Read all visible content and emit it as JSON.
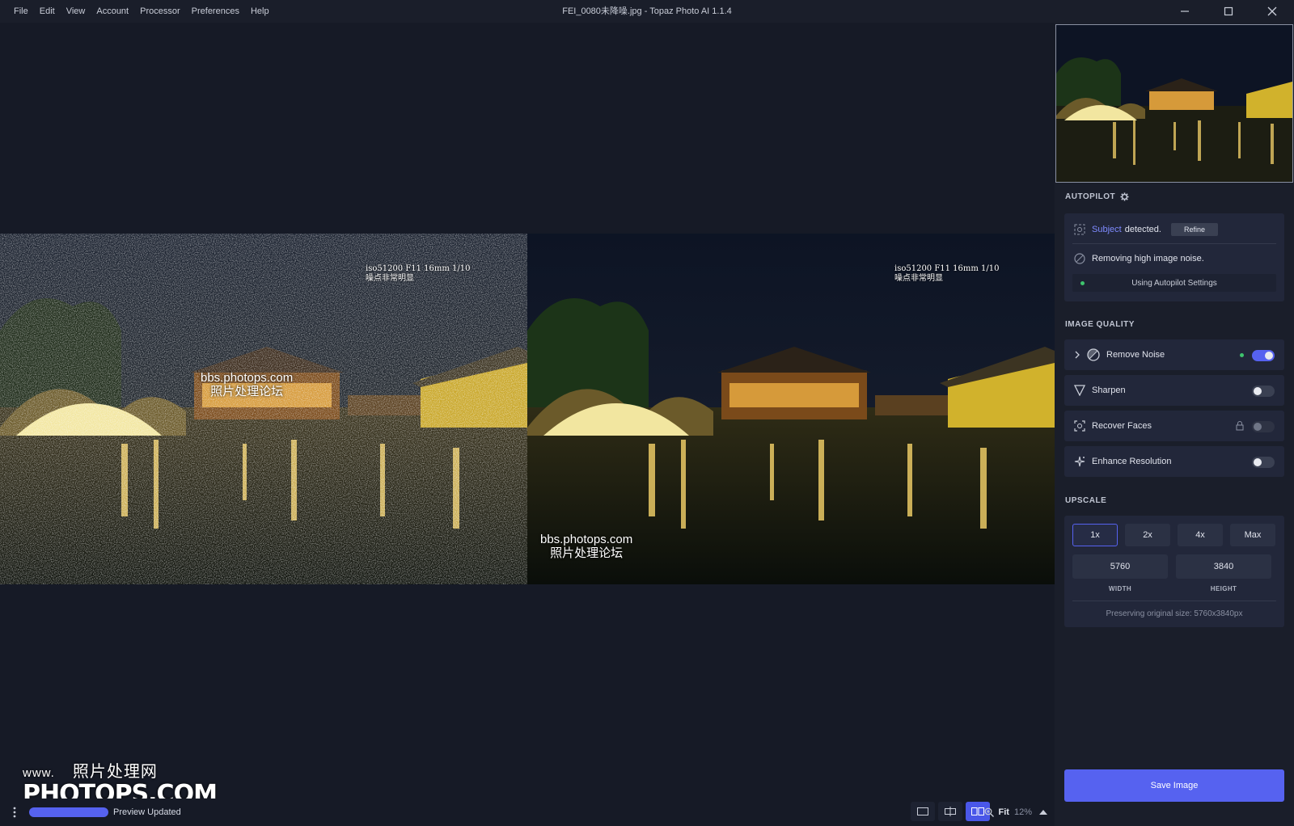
{
  "window": {
    "title": "FEI_0080未降噪.jpg - Topaz Photo AI 1.1.4",
    "menu": [
      "File",
      "Edit",
      "View",
      "Account",
      "Processor",
      "Preferences",
      "Help"
    ]
  },
  "canvas": {
    "left_overlay": {
      "exif_line1": "iso51200 F11 16mm 1/10",
      "exif_line2": "噪点非常明显"
    },
    "right_overlay": {
      "exif_line1": "iso51200 F11 16mm 1/10",
      "exif_line2": "噪点非常明显"
    },
    "watermark_left": {
      "line1": "bbs.photops.com",
      "line2": "照片处理论坛"
    },
    "watermark_right": {
      "line1": "bbs.photops.com",
      "line2": "照片处理论坛"
    },
    "brand_watermark": {
      "line1_prefix": "www.",
      "line1": "照片处理网",
      "line2": "PHOTOPS.COM"
    }
  },
  "statusbar": {
    "preview_label": "Preview Updated",
    "preview_progress": 1.0,
    "zoom_fit": "Fit",
    "zoom_pct": "12%",
    "active_view_mode": "side-by-side"
  },
  "autopilot": {
    "heading": "AUTOPILOT",
    "subject_word": "Subject",
    "detected_text": "detected.",
    "refine_label": "Refine",
    "noise_msg": "Removing high image noise.",
    "settings_label": "Using Autopilot Settings"
  },
  "image_quality": {
    "heading": "IMAGE QUALITY",
    "items": [
      {
        "label": "Remove Noise",
        "enabled": true
      },
      {
        "label": "Sharpen",
        "enabled": false
      },
      {
        "label": "Recover Faces",
        "enabled": false,
        "locked": true
      },
      {
        "label": "Enhance Resolution",
        "enabled": false
      }
    ]
  },
  "upscale": {
    "heading": "UPSCALE",
    "options": [
      "1x",
      "2x",
      "4x",
      "Max"
    ],
    "selected": "1x",
    "width_value": "5760",
    "height_value": "3840",
    "width_label": "WIDTH",
    "height_label": "HEIGHT",
    "preserve_text": "Preserving original size: 5760x3840px"
  },
  "save_label": "Save Image",
  "colors": {
    "accent": "#5662f0",
    "panel": "#1a1e2a",
    "card": "#22273a",
    "background": "#161a26",
    "ok": "#3ec46d"
  },
  "icons": [
    "gear-icon",
    "subject-icon",
    "noise-icon",
    "chevron-right-icon",
    "sharpen-icon",
    "face-icon",
    "lock-icon",
    "enhance-icon",
    "zoom-icon",
    "caret-up-icon",
    "more-icon",
    "single-view-icon",
    "split-view-icon",
    "side-by-side-icon",
    "minimize-icon",
    "maximize-icon",
    "close-icon"
  ]
}
